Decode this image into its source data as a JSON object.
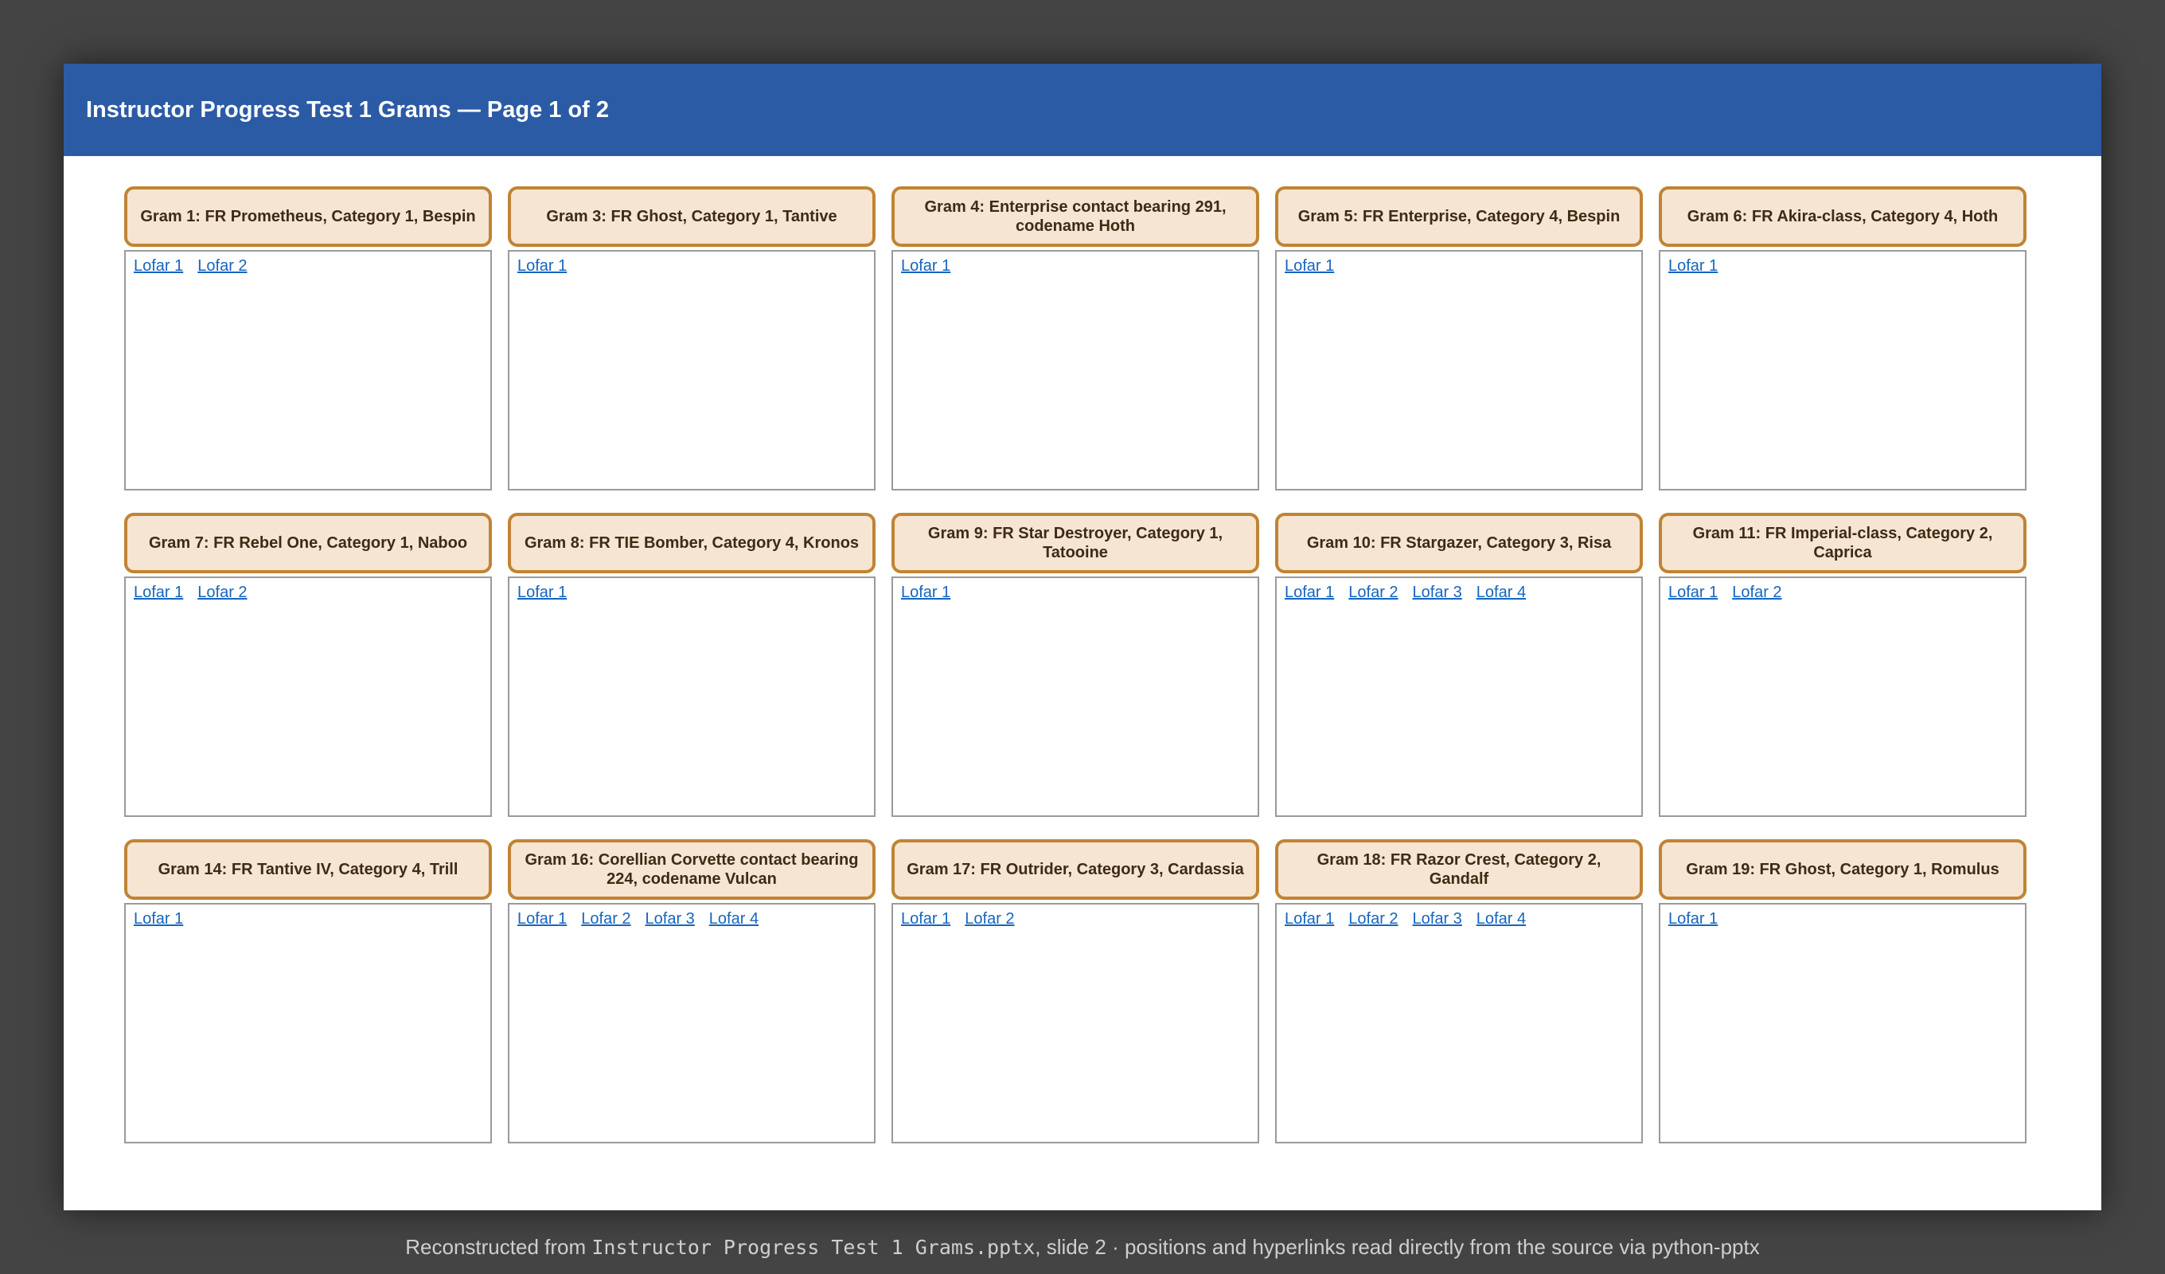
{
  "slide": {
    "title": "Instructor Progress Test 1 Grams — Page 1 of 2"
  },
  "grams": [
    {
      "title": "Gram 1: FR Prometheus, Category 1, Bespin",
      "lofars": [
        "Lofar 1",
        "Lofar 2"
      ]
    },
    {
      "title": "Gram 3: FR Ghost, Category 1, Tantive",
      "lofars": [
        "Lofar 1"
      ]
    },
    {
      "title": "Gram 4: Enterprise contact bearing 291, codename Hoth",
      "lofars": [
        "Lofar 1"
      ]
    },
    {
      "title": "Gram 5: FR Enterprise, Category 4, Bespin",
      "lofars": [
        "Lofar 1"
      ]
    },
    {
      "title": "Gram 6: FR Akira-class, Category 4, Hoth",
      "lofars": [
        "Lofar 1"
      ]
    },
    {
      "title": "Gram 7: FR Rebel One, Category 1, Naboo",
      "lofars": [
        "Lofar 1",
        "Lofar 2"
      ]
    },
    {
      "title": "Gram 8: FR TIE Bomber, Category 4, Kronos",
      "lofars": [
        "Lofar 1"
      ]
    },
    {
      "title": "Gram 9: FR Star Destroyer, Category 1, Tatooine",
      "lofars": [
        "Lofar 1"
      ]
    },
    {
      "title": "Gram 10: FR Stargazer, Category 3, Risa",
      "lofars": [
        "Lofar 1",
        "Lofar 2",
        "Lofar 3",
        "Lofar 4"
      ]
    },
    {
      "title": "Gram 11: FR Imperial-class, Category 2, Caprica",
      "lofars": [
        "Lofar 1",
        "Lofar 2"
      ]
    },
    {
      "title": "Gram 14: FR Tantive IV, Category 4, Trill",
      "lofars": [
        "Lofar 1"
      ]
    },
    {
      "title": "Gram 16: Corellian Corvette contact bearing 224, codename Vulcan",
      "lofars": [
        "Lofar 1",
        "Lofar 2",
        "Lofar 3",
        "Lofar 4"
      ]
    },
    {
      "title": "Gram 17: FR Outrider, Category 3, Cardassia",
      "lofars": [
        "Lofar 1",
        "Lofar 2"
      ]
    },
    {
      "title": "Gram 18: FR Razor Crest, Category 2, Gandalf",
      "lofars": [
        "Lofar 1",
        "Lofar 2",
        "Lofar 3",
        "Lofar 4"
      ]
    },
    {
      "title": "Gram 19: FR Ghost, Category 1, Romulus",
      "lofars": [
        "Lofar 1"
      ]
    }
  ],
  "footer": {
    "prefix": "Reconstructed from ",
    "filename": "Instructor Progress Test 1 Grams.pptx",
    "suffix": ", slide 2 · positions and hyperlinks read directly from the source via python-pptx"
  },
  "colors": {
    "header_bar": "#2b5ba5",
    "gram_header_fill": "#f6e5d3",
    "gram_header_border": "#c08434",
    "link": "#1565c0",
    "backdrop": "#444444"
  }
}
